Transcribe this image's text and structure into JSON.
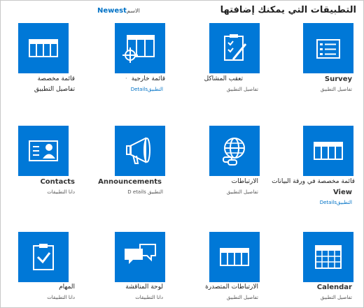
{
  "header": {
    "title": "التطبيقات التي يمكنك إضافتها",
    "sort_newest": "Newest",
    "sort_name": "الاسم"
  },
  "apps": [
    {
      "name": "Survey",
      "details": "تفاصيل التطبيق"
    },
    {
      "name": "تعقب المشاكل",
      "details": "تفاصيل التطبيق"
    },
    {
      "name": "قائمة خارجية",
      "details": "التطبيقDetails"
    },
    {
      "name": "قائمة مخصصة",
      "details": "تفاصيل التطبيق"
    },
    {
      "name": "قائمة مخصصة في ورقة البيانات",
      "name2": "View",
      "details": "التطبيقDetails"
    },
    {
      "name": "الارتباطات",
      "details": "تفاصيل التطبيق"
    },
    {
      "name": "Announcements",
      "details": "التطبيق D etails"
    },
    {
      "name": "Contacts",
      "details": "دانا التطبيقات"
    },
    {
      "name": "Calendar",
      "details": "تفاصيل التطبيق"
    },
    {
      "name": "الارتباطات المتصدرة",
      "details": "تفاصيل التطبيق"
    },
    {
      "name": "لوحة المناقشة",
      "details": "دانا التطبيقات"
    },
    {
      "name": "المهام",
      "details": "دانا التطبيقات"
    }
  ],
  "colors": {
    "tile": "#0078d7",
    "link": "#0072c6"
  },
  "icons": [
    "survey-icon",
    "issue-tracking-icon",
    "external-list-icon",
    "custom-list-icon",
    "datasheet-list-icon",
    "links-icon",
    "announcements-icon",
    "contacts-icon",
    "calendar-icon",
    "promoted-links-icon",
    "discussion-board-icon",
    "tasks-icon"
  ]
}
